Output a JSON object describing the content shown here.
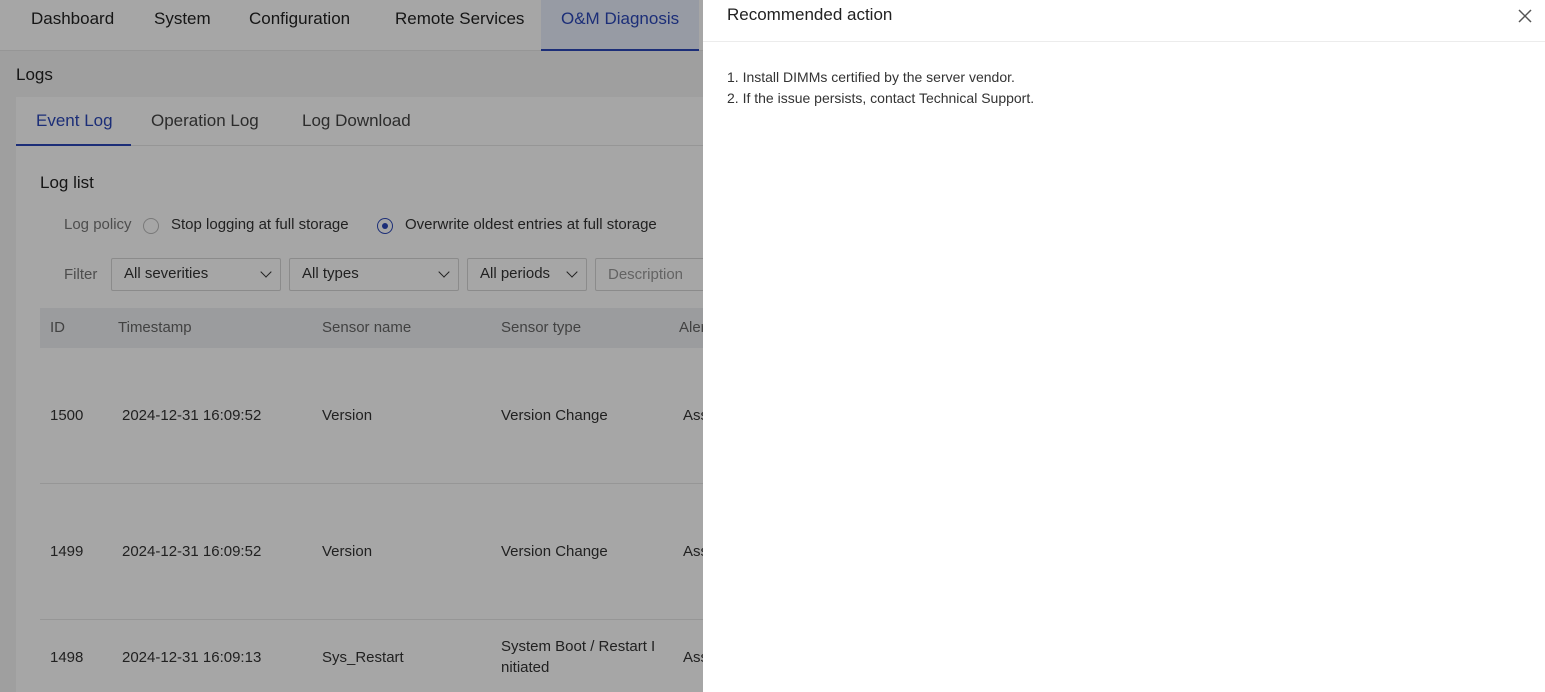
{
  "nav": {
    "items": [
      "Dashboard",
      "System",
      "Configuration",
      "Remote Services",
      "O&M Diagnosis"
    ],
    "active": "O&M Diagnosis"
  },
  "page": {
    "title": "Logs",
    "tabs": [
      "Event Log",
      "Operation Log",
      "Log Download"
    ],
    "active_tab": "Event Log"
  },
  "log_list": {
    "title": "Log list",
    "policy_label": "Log policy",
    "policy_options": [
      "Stop logging at full storage",
      "Overwrite oldest entries at full storage"
    ],
    "policy_selected": "Overwrite oldest entries at full storage",
    "filter_label": "Filter",
    "filters": {
      "severity": "All severities",
      "type": "All types",
      "period": "All periods",
      "description_placeholder": "Description"
    },
    "columns": [
      "ID",
      "Timestamp",
      "Sensor name",
      "Sensor type",
      "Aler"
    ],
    "rows": [
      {
        "id": "1500",
        "timestamp": "2024-12-31 16:09:52",
        "sensor_name": "Version",
        "sensor_type": "Version Change",
        "alert": "Ass"
      },
      {
        "id": "1499",
        "timestamp": "2024-12-31 16:09:52",
        "sensor_name": "Version",
        "sensor_type": "Version Change",
        "alert": "Ass"
      },
      {
        "id": "1498",
        "timestamp": "2024-12-31 16:09:13",
        "sensor_name": "Sys_Restart",
        "sensor_type_line1": "System Boot / Restart I",
        "sensor_type_line2": "nitiated",
        "alert": "Ass"
      }
    ]
  },
  "drawer": {
    "title": "Recommended action",
    "lines": [
      "1. Install DIMMs certified by the server vendor.",
      "2. If the issue persists, contact Technical Support."
    ]
  },
  "colors": {
    "accent": "#2b48b8",
    "overlay": "rgba(0,0,0,0.35)"
  }
}
